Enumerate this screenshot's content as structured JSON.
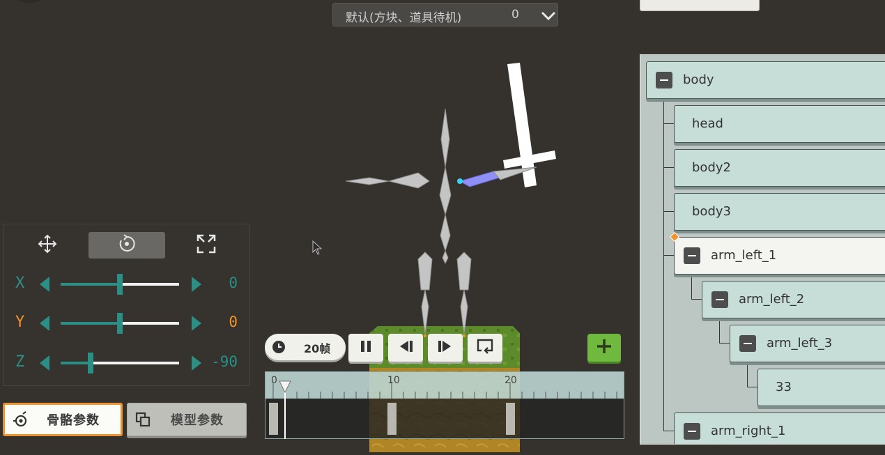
{
  "animation_select": {
    "label": "默认(方块、道具待机)",
    "value": "0"
  },
  "transform_panel": {
    "modes": [
      {
        "name": "move",
        "icon": "move-arrows-icon",
        "active": false
      },
      {
        "name": "rotate",
        "icon": "rotate-icon",
        "active": true
      },
      {
        "name": "scale",
        "icon": "scale-expand-icon",
        "active": false
      }
    ],
    "axes": [
      {
        "label": "X",
        "value": "0",
        "label_color": "#2b8f86",
        "value_color": "#2b8f86",
        "slider_fraction": 0.5
      },
      {
        "label": "Y",
        "value": "0",
        "label_color": "#f0922d",
        "value_color": "#f0922d",
        "slider_fraction": 0.5
      },
      {
        "label": "Z",
        "value": "-90",
        "label_color": "#2b8f86",
        "value_color": "#2b8f86",
        "slider_fraction": 0.25
      }
    ]
  },
  "param_tabs": {
    "bone": "骨骼参数",
    "model": "模型参数"
  },
  "playback": {
    "fps": "20帧"
  },
  "timeline": {
    "ticks": [
      "0",
      "10",
      "20"
    ],
    "current_frame": 0,
    "keyframes": [
      0,
      10,
      20
    ]
  },
  "bone_tree": [
    {
      "name": "body",
      "depth": 0,
      "collapsible": true,
      "selected": false
    },
    {
      "name": "head",
      "depth": 1,
      "collapsible": false,
      "selected": false
    },
    {
      "name": "body2",
      "depth": 1,
      "collapsible": false,
      "selected": false
    },
    {
      "name": "body3",
      "depth": 1,
      "collapsible": false,
      "selected": false
    },
    {
      "name": "arm_left_1",
      "depth": 1,
      "collapsible": true,
      "selected": true
    },
    {
      "name": "arm_left_2",
      "depth": 2,
      "collapsible": true,
      "selected": false
    },
    {
      "name": "arm_left_3",
      "depth": 3,
      "collapsible": true,
      "selected": false
    },
    {
      "name": "33",
      "depth": 4,
      "collapsible": false,
      "selected": false
    },
    {
      "name": "arm_right_1",
      "depth": 1,
      "collapsible": true,
      "selected": false
    }
  ],
  "colors": {
    "accent_teal": "#2b8f86",
    "accent_orange": "#f0922d",
    "add_green": "#6fba3e"
  }
}
